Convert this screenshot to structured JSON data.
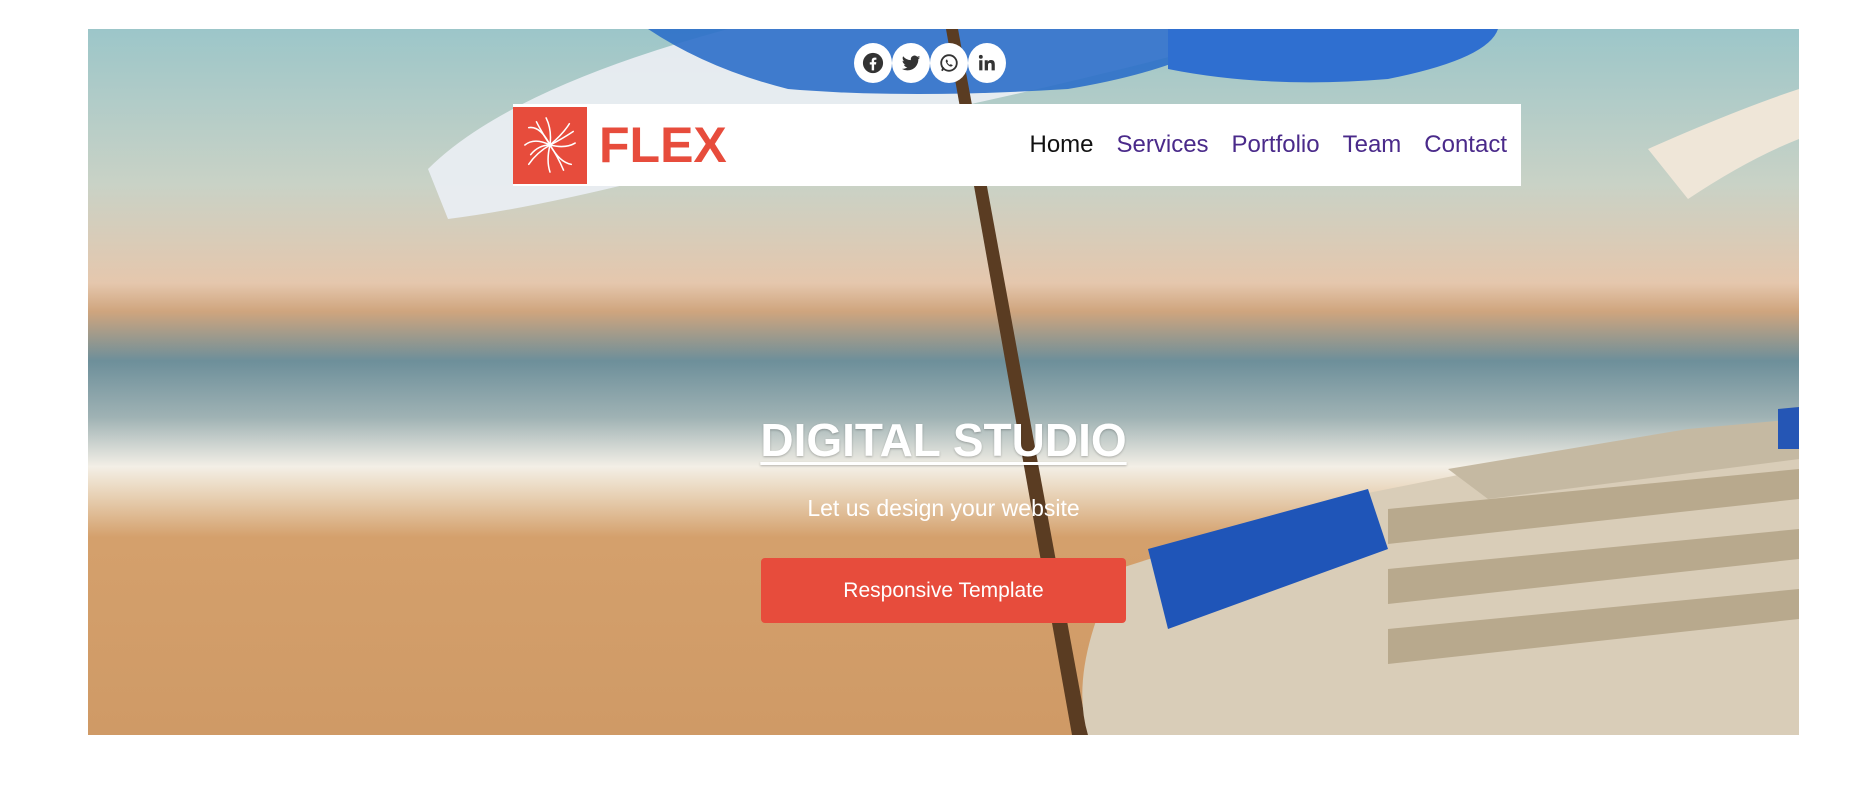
{
  "social": {
    "items": [
      {
        "icon": "facebook-icon"
      },
      {
        "icon": "twitter-icon"
      },
      {
        "icon": "whatsapp-icon"
      },
      {
        "icon": "linkedin-icon"
      }
    ]
  },
  "brand": {
    "name": "FLEX",
    "color": "#e74c3c"
  },
  "nav": {
    "items": [
      {
        "label": "Home"
      },
      {
        "label": "Services"
      },
      {
        "label": "Portfolio"
      },
      {
        "label": "Team"
      },
      {
        "label": "Contact"
      }
    ],
    "active_color": "#111111",
    "link_color": "#4a2a8a"
  },
  "hero": {
    "title": "DIGITAL STUDIO",
    "subtitle": "Let us design your website",
    "cta_label": "Responsive Template",
    "cta_color": "#e74c3c"
  }
}
